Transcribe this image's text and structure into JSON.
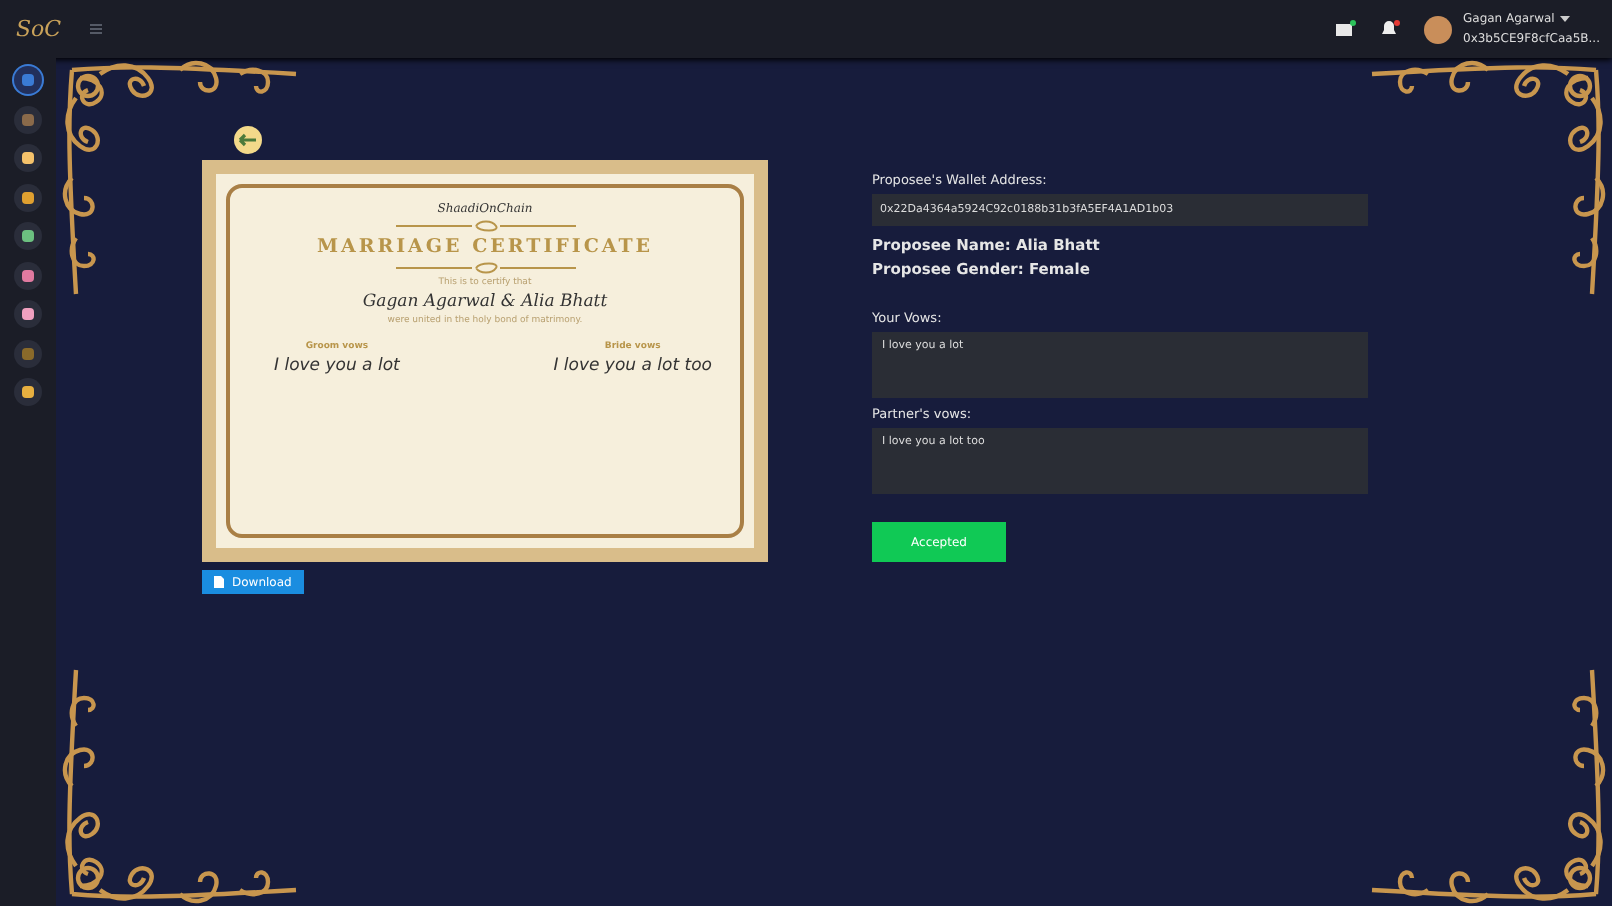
{
  "header": {
    "logo": "SoC",
    "user_name": "Gagan Agarwal",
    "user_address": "0x3b5CE9F8cfCaa5B..."
  },
  "sidebar": {
    "items": [
      {
        "selected": true
      },
      {
        "selected": false
      },
      {
        "selected": false
      },
      {
        "selected": false
      },
      {
        "selected": false
      },
      {
        "selected": false
      },
      {
        "selected": false
      },
      {
        "selected": false
      },
      {
        "selected": false
      }
    ]
  },
  "certificate": {
    "brand": "ShaadiOnChain",
    "title": "MARRIAGE CERTIFICATE",
    "intro": "This is to certify that",
    "names": "Gagan Agarwal & Alia Bhatt",
    "outro": "were united in the holy bond of matrimony.",
    "vows": [
      {
        "label": "Groom vows",
        "text": "I love you a lot"
      },
      {
        "label": "Bride vows",
        "text": "I love you a lot too"
      }
    ]
  },
  "download_button": "Download",
  "details": {
    "wallet_label": "Proposee's Wallet Address:",
    "wallet_value": "0x22Da4364a5924C92c0188b31b3fA5EF4A1AD1b03",
    "name_line": "Proposee Name: Alia Bhatt",
    "gender_line": "Proposee Gender: Female",
    "your_vows_label": "Your Vows:",
    "your_vows": "I love you a lot",
    "partner_vows_label": "Partner's vows:",
    "partner_vows": "I love you a lot too",
    "status_button": "Accepted"
  }
}
